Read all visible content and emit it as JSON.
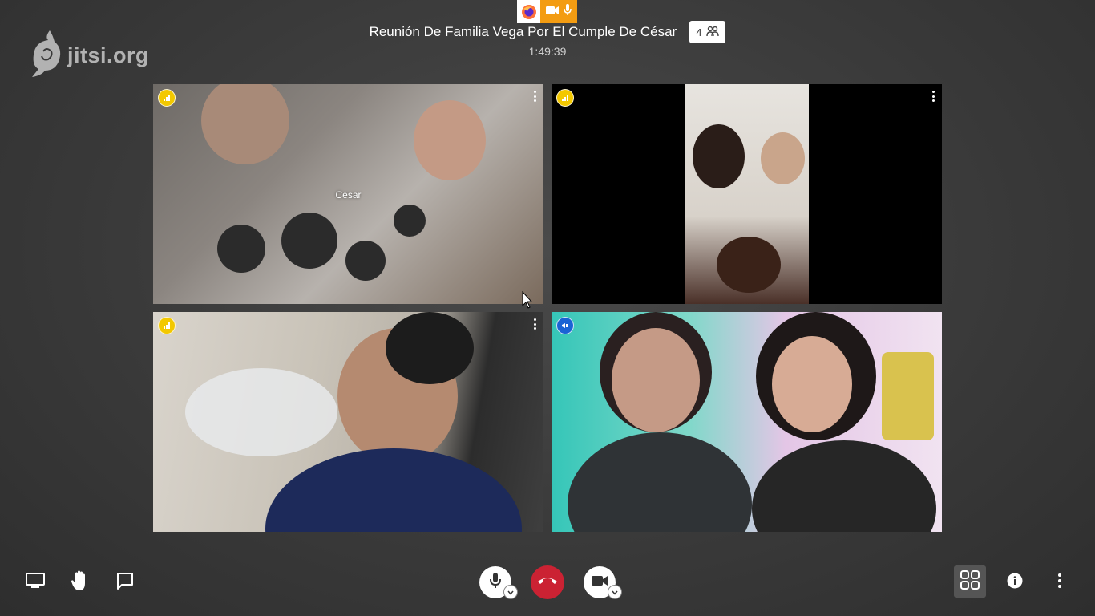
{
  "header": {
    "subject": "Reunión De Familia Vega Por El Cumple De César",
    "participant_count": "4",
    "timer": "1:49:39"
  },
  "logo": {
    "text": "jitsi.org"
  },
  "tiles": [
    {
      "name": "Cesar",
      "connection": "yellow"
    },
    {
      "name": "",
      "connection": "yellow"
    },
    {
      "name": "",
      "connection": "yellow"
    },
    {
      "name": "",
      "connection": "blue",
      "active_speaker": true
    }
  ],
  "colors": {
    "hangup": "#cb2233",
    "active_border": "#1a63d4",
    "connection_good": "#f3c800",
    "share_indicator": "#f39c12"
  },
  "toolbar": {
    "left": [
      "screen-share-icon",
      "raise-hand-icon",
      "chat-icon"
    ],
    "center": [
      "microphone-icon",
      "hangup-icon",
      "camera-icon"
    ],
    "right": [
      "tile-view-icon",
      "info-icon",
      "more-options-icon"
    ]
  }
}
